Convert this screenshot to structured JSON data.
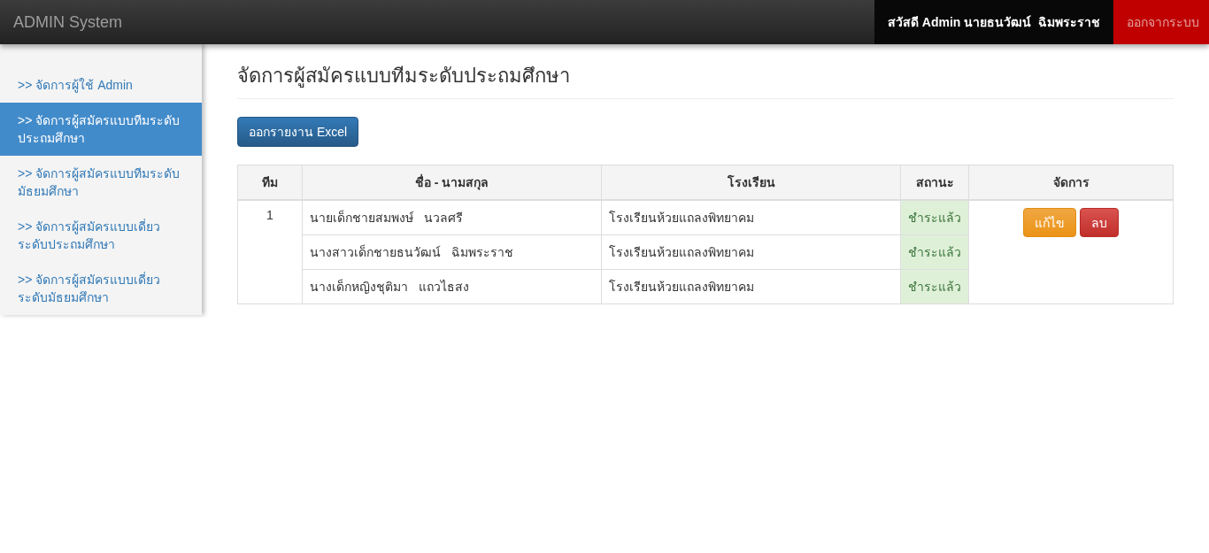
{
  "navbar": {
    "brand": "ADMIN System",
    "greeting": "สวัสดี Admin นายธนวัฒน์  ฉิมพระราช",
    "logout": "ออกจากระบบ"
  },
  "sidebar": {
    "items": [
      {
        "label": ">> จัดการผู้ใช้ Admin",
        "selected": false
      },
      {
        "label": ">> จัดการผู้สมัครแบบทีมระดับประถมศึกษา",
        "selected": true
      },
      {
        "label": ">> จัดการผู้สมัครแบบทีมระดับมัธยมศึกษา",
        "selected": false
      },
      {
        "label": ">> จัดการผู้สมัครแบบเดี่ยวระดับประถมศึกษา",
        "selected": false
      },
      {
        "label": ">> จัดการผู้สมัครแบบเดี่ยวระดับมัธยมศึกษา",
        "selected": false
      }
    ]
  },
  "page": {
    "title": "จัดการผู้สมัครแบบทีมระดับประถมศึกษา",
    "export_button": "ออกรายงาน Excel"
  },
  "table": {
    "columns": [
      "ทีม",
      "ชื่อ - นามสกุล",
      "โรงเรียน",
      "สถานะ",
      "จัดการ"
    ],
    "teams": [
      {
        "team": "1",
        "members": [
          {
            "name": "นายเด็กชายสมพงษ์   นวลศรี",
            "school": "โรงเรียนห้วยแถลงพิทยาคม",
            "status": {
              "label": "ชำระแล้ว",
              "kind": "paid"
            }
          },
          {
            "name": "นางสาวเด็กชายธนวัฒน์   ฉิมพระราช",
            "school": "โรงเรียนห้วยแถลงพิทยาคม",
            "status": {
              "label": "ชำระแล้ว",
              "kind": "paid"
            }
          },
          {
            "name": "นางเด็กหญิงชุติมา   แถวไธสง",
            "school": "โรงเรียนห้วยแถลงพิทยาคม",
            "status": {
              "label": "ชำระแล้ว",
              "kind": "paid"
            }
          }
        ],
        "actions": [
          {
            "label": "แก้ไข",
            "kind": "edit"
          },
          {
            "label": "ลบ",
            "kind": "delete"
          }
        ]
      }
    ]
  }
}
